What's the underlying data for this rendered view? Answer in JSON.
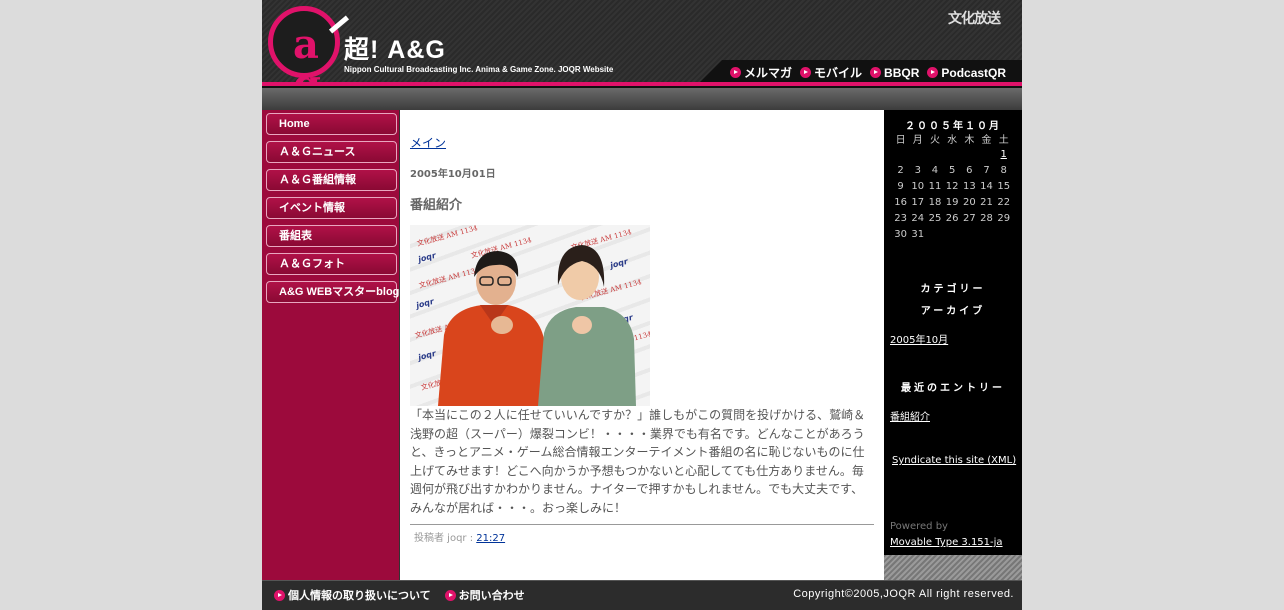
{
  "header": {
    "logo_mark": "a g",
    "title": "超! A&G",
    "tagline": "Nippon Cultural Broadcasting Inc. Anima & Game Zone. JOQR Website",
    "station_logo": "文化放送",
    "nav": [
      {
        "label": "メルマガ"
      },
      {
        "label": "モバイル"
      },
      {
        "label": "BBQR"
      },
      {
        "label": "PodcastQR"
      }
    ]
  },
  "leftnav": {
    "items": [
      {
        "label": "Home"
      },
      {
        "label": "Ａ＆Ｇニュース"
      },
      {
        "label": "Ａ＆Ｇ番組情報"
      },
      {
        "label": "イベント情報"
      },
      {
        "label": "番組表"
      },
      {
        "label": "Ａ＆Ｇフォト"
      },
      {
        "label": "A&G WEBマスターblog"
      }
    ]
  },
  "main": {
    "breadcrumb": "メイン",
    "date": "2005年10月01日",
    "entry_title": "番組紹介",
    "photo_alt": "文化放送 AM 1134",
    "body": "「本当にこの２人に任せていいんですか？」誰しもがこの質問を投げかける、鷲崎＆浅野の超（スーパー）爆裂コンビ！・・・・業界でも有名です。どんなことがあろうと、きっとアニメ・ゲーム総合情報エンターテイメント番組の名に恥じないものに仕上げてみせます！どこへ向かうか予想もつかないと心配してても仕方ありません。毎週何が飛び出すかわかりません。ナイターで押すかもしれません。でも大丈夫です、みんなが居れば・・・。おっ楽しみに！",
    "footer_prefix": "投稿者 joqr : ",
    "footer_time": "21:27"
  },
  "sidebar": {
    "calendar": {
      "title": "２００５年１０月",
      "weekdays": [
        "日",
        "月",
        "火",
        "水",
        "木",
        "金",
        "土"
      ],
      "weeks": [
        [
          "",
          "",
          "",
          "",
          "",
          "",
          "1"
        ],
        [
          "2",
          "3",
          "4",
          "5",
          "6",
          "7",
          "8"
        ],
        [
          "9",
          "10",
          "11",
          "12",
          "13",
          "14",
          "15"
        ],
        [
          "16",
          "17",
          "18",
          "19",
          "20",
          "21",
          "22"
        ],
        [
          "23",
          "24",
          "25",
          "26",
          "27",
          "28",
          "29"
        ],
        [
          "30",
          "31",
          "",
          "",
          "",
          "",
          ""
        ]
      ],
      "linked_days": [
        "1"
      ]
    },
    "categories_heading": "カテゴリー",
    "archives_heading": "アーカイブ",
    "archive_link": "2005年10月",
    "recent_heading": "最近のエントリー",
    "recent_link": "番組紹介",
    "syndicate_link": "Syndicate this site (XML)",
    "powered_by": "Powered by",
    "mt_link": "Movable Type 3.151-ja"
  },
  "footer": {
    "links": [
      {
        "label": "個人情報の取り扱いについて"
      },
      {
        "label": "お問い合わせ"
      }
    ],
    "copyright": "Copyright©2005,JOQR All right reserved."
  },
  "colors": {
    "accent_pink": "#e0126a",
    "nav_crimson": "#9c0a3c",
    "link_blue": "#003399"
  }
}
